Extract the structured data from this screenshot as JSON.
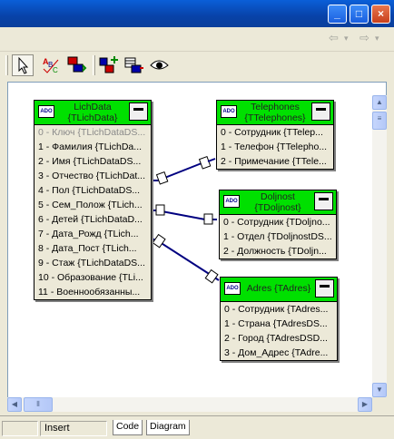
{
  "window": {
    "minimize": "_",
    "maximize": "□",
    "close": "×"
  },
  "nav": {
    "back": "⇦",
    "back_dd": "▾",
    "forward": "⇨",
    "forward_dd": "▾"
  },
  "entities": [
    {
      "title1": "LichData",
      "title2": "{TLichData}",
      "rows": [
        "0 - Ключ {TLichDataDS...",
        "1 - Фамилия {TLichDa...",
        "2 - Имя {TLichDataDS...",
        "3 - Отчество {TLichDat...",
        "4 - Пол {TLichDataDS...",
        "5 - Сем_Полож {TLich...",
        "6 - Детей {TLichDataD...",
        "7 - Дата_Рожд {TLich...",
        "8 - Дата_Пост {TLich...",
        "9 - Стаж {TLichDataDS...",
        "10 - Образование {TLi...",
        "11 - Военнообязанны..."
      ]
    },
    {
      "title1": "Telephones",
      "title2": "{TTelephones}",
      "rows": [
        "0 - Сотрудник {TTelep...",
        "1 - Телефон {TTelepho...",
        "2 - Примечание {TTele..."
      ]
    },
    {
      "title1": "Doljnost",
      "title2": "{TDoljnost}",
      "rows": [
        "0 - Сотрудник {TDoljno...",
        "1 - Отдел {TDoljnostDS...",
        "2 - Должность {TDoljn..."
      ]
    },
    {
      "title1": "Adres {TAdres}",
      "rows": [
        "0 - Сотрудник {TAdres...",
        "1 - Страна {TAdresDS...",
        "2 - Город {TAdresDSD...",
        "3 - Дом_Адрес {TAdre..."
      ]
    }
  ],
  "statusbar": {
    "mode": "Insert",
    "tab_code": "Code",
    "tab_diagram": "Diagram"
  },
  "colors": {
    "entity_header": "#00e000",
    "link": "#000080",
    "titlebar": "#0842a8"
  }
}
